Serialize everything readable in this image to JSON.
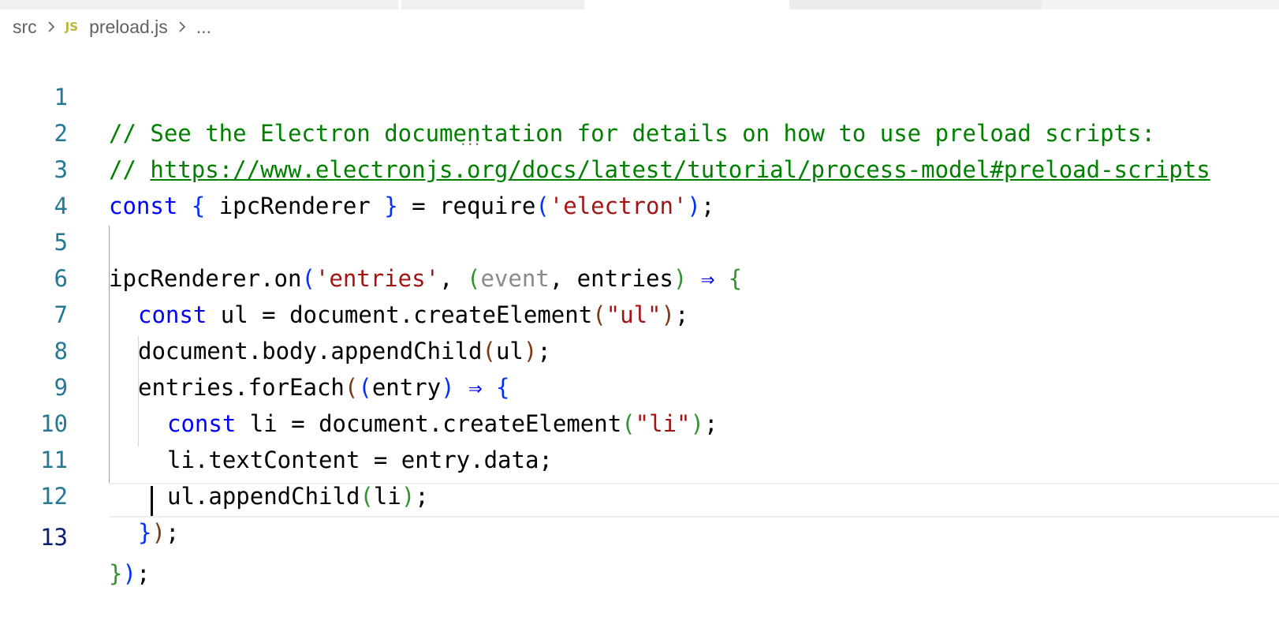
{
  "breadcrumb": {
    "folder": "src",
    "file_icon": "JS",
    "file": "preload.js",
    "more": "..."
  },
  "editor": {
    "lines": [
      {
        "n": "1"
      },
      {
        "n": "2"
      },
      {
        "n": "3"
      },
      {
        "n": "4"
      },
      {
        "n": "5"
      },
      {
        "n": "6"
      },
      {
        "n": "7"
      },
      {
        "n": "8"
      },
      {
        "n": "9"
      },
      {
        "n": "10"
      },
      {
        "n": "11"
      },
      {
        "n": "12"
      },
      {
        "n": "13"
      }
    ],
    "code": {
      "l1": "// See the Electron documentation for details on how to use preload scripts:",
      "l2_prefix": "// ",
      "l2_link": "https://www.electronjs.org/docs/latest/tutorial/process-model#preload-scripts",
      "l3": {
        "kw": "const",
        "lb": "{",
        "id": " ipcRenderer ",
        "rb": "}",
        "eq": " = ",
        "fn": "require",
        "lp": "(",
        "str": "'electron'",
        "rp": ")",
        "semi": ";"
      },
      "l5": {
        "obj": "ipcRenderer.on",
        "lp": "(",
        "str": "'entries'",
        "comma": ", ",
        "lp2": "(",
        "p1": "event",
        "comma2": ", ",
        "p2": "entries",
        "rp2": ")",
        "arrow": " ⇒ ",
        "lb": "{"
      },
      "l6": {
        "kw": "const",
        "rest": " ul = document.createElement",
        "lp": "(",
        "str": "\"ul\"",
        "rp": ")",
        "semi": ";"
      },
      "l7": {
        "a": "document.body.appendChild",
        "lp": "(",
        "b": "ul",
        "rp": ")",
        "semi": ";"
      },
      "l8": {
        "a": "entries.forEach",
        "lp": "(",
        "lp2": "(",
        "b": "entry",
        "rp2": ")",
        "arrow": " ⇒ ",
        "lb": "{"
      },
      "l9": {
        "kw": "const",
        "rest": " li = document.createElement",
        "lp": "(",
        "str": "\"li\"",
        "rp": ")",
        "semi": ";"
      },
      "l10": {
        "a": "li.textContent = entry.data;"
      },
      "l11": {
        "a": "ul.appendChild",
        "lp": "(",
        "b": "li",
        "rp": ")",
        "semi": ";"
      },
      "l12": {
        "rb": "}",
        "rp": ")",
        "semi": ";"
      },
      "l13": {
        "rb": "}",
        "rp": ")",
        "semi": ";"
      }
    },
    "hover_hint": "..."
  },
  "colors": {
    "comment": "#008000",
    "keyword": "#0000ff",
    "string": "#a31515",
    "line_number": "#237893",
    "active_line_number": "#0b216f"
  }
}
